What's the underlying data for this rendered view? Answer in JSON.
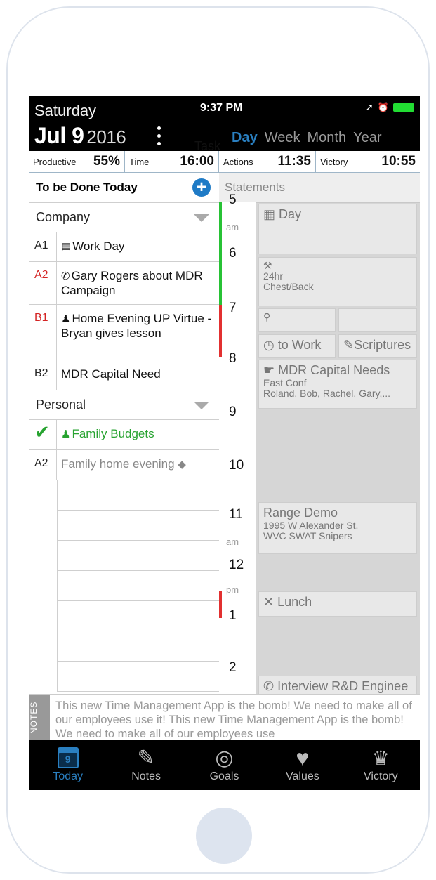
{
  "status": {
    "weekday": "Saturday",
    "time": "9:37 PM",
    "icons": [
      "location-arrow-icon",
      "alarm-icon",
      "battery-icon"
    ]
  },
  "header": {
    "month_day": "Jul 9",
    "year": "2016",
    "tabs": [
      "Task",
      "Day",
      "Week",
      "Month",
      "Year"
    ],
    "active_tab": "Day"
  },
  "metrics": [
    {
      "label": "Productive",
      "value": "55%"
    },
    {
      "label": "Time",
      "value": "16:00"
    },
    {
      "label": "Actions",
      "value": "11:35"
    },
    {
      "label": "Victory",
      "value": "10:55"
    }
  ],
  "todo": {
    "title": "To be Done Today",
    "add_icon": "plus-circle-icon",
    "sections": [
      {
        "name": "Company",
        "items": [
          {
            "priority": "A1",
            "icon": "briefcase-icon",
            "text": "Work Day"
          },
          {
            "priority": "A2",
            "icon": "phone-icon",
            "text": "Gary Rogers about MDR Campaign"
          },
          {
            "priority": "B1",
            "icon": "person-icon",
            "text": "Home Evening UP Virtue - Bryan gives lesson"
          },
          {
            "priority": "B2",
            "icon": "",
            "text": "MDR Capital Need"
          }
        ]
      },
      {
        "name": "Personal",
        "items": [
          {
            "priority": "✔",
            "icon": "group-icon",
            "text": "Family Budgets"
          },
          {
            "priority": "A2",
            "icon": "tag-icon",
            "text": "Family home evening"
          }
        ]
      }
    ]
  },
  "timeline": {
    "header": "Statements",
    "hours": [
      {
        "label": "5",
        "sub": "am"
      },
      {
        "label": "6",
        "sub": ""
      },
      {
        "label": "7",
        "sub": ""
      },
      {
        "label": "8",
        "sub": ""
      },
      {
        "label": "9",
        "sub": ""
      },
      {
        "label": "10",
        "sub": ""
      },
      {
        "label": "11",
        "sub": "am"
      },
      {
        "label": "12",
        "sub": "pm"
      },
      {
        "label": "1",
        "sub": ""
      },
      {
        "label": "2",
        "sub": ""
      }
    ],
    "events": [
      {
        "title": "Day",
        "lines": []
      },
      {
        "title": "",
        "lines": [
          "24hr",
          "Chest/Back"
        ]
      },
      {
        "title": "to Work",
        "lines": []
      },
      {
        "title": "Scriptures",
        "lines": []
      },
      {
        "title": "MDR Capital Needs",
        "lines": [
          "East Conf",
          "Roland, Bob, Rachel, Gary,..."
        ]
      },
      {
        "title": "Range Demo",
        "lines": [
          "1995 W Alexander St.",
          "WVC SWAT Snipers"
        ]
      },
      {
        "title": "Lunch",
        "lines": []
      },
      {
        "title": "Interview R&D Enginee",
        "lines": []
      }
    ]
  },
  "notes": {
    "tab": "NOTES",
    "text": "This new Time Management App is the bomb!  We need to make all of our employees use it!  This new Time Management App is the bomb!  We need to make all of our employees use"
  },
  "nav": {
    "items": [
      "Today",
      "Notes",
      "Goals",
      "Values",
      "Victory"
    ],
    "active": "Today",
    "calendar_day": "9"
  },
  "colors": {
    "accent": "#2a7fc0",
    "done_green": "#27a330",
    "overdue_red": "#d42424"
  }
}
